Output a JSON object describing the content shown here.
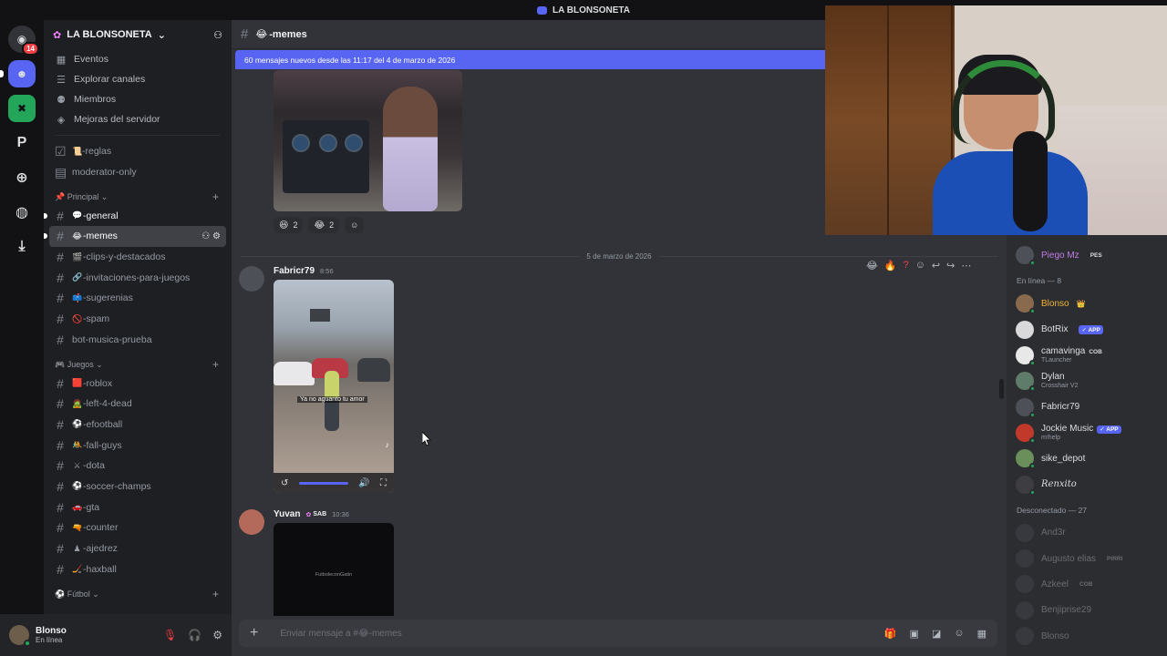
{
  "window": {
    "title": "LA BLONSONETA"
  },
  "rail": {
    "dm_badge": "14",
    "letter_server": "P"
  },
  "server": {
    "name": "LA BLONSONETA"
  },
  "nav": [
    {
      "label": "Eventos"
    },
    {
      "label": "Explorar canales"
    },
    {
      "label": "Miembros"
    },
    {
      "label": "Mejoras del servidor"
    }
  ],
  "top_channels": [
    {
      "emoji": "📜",
      "label": "-reglas"
    },
    {
      "emoji": "",
      "label": "moderator-only"
    }
  ],
  "categories": {
    "principal": "Principal",
    "juegos": "Juegos",
    "futbol": "Fútbol"
  },
  "principal_channels": [
    {
      "emoji": "💬",
      "label": "-general"
    },
    {
      "emoji": "😂",
      "label": "-memes"
    },
    {
      "emoji": "🎬",
      "label": "-clips-y-destacados"
    },
    {
      "emoji": "🔗",
      "label": "-invitaciones-para-juegos"
    },
    {
      "emoji": "📫",
      "label": "-sugerenias"
    },
    {
      "emoji": "🚫",
      "label": "-spam"
    },
    {
      "emoji": "",
      "label": "bot-musica-prueba"
    }
  ],
  "juegos_channels": [
    {
      "emoji": "🟥",
      "label": "-roblox"
    },
    {
      "emoji": "🧟",
      "label": "-left-4-dead"
    },
    {
      "emoji": "⚽",
      "label": "-efootball"
    },
    {
      "emoji": "🤼",
      "label": "-fall-guys"
    },
    {
      "emoji": "⚔",
      "label": "-dota"
    },
    {
      "emoji": "⚽",
      "label": "-soccer-champs"
    },
    {
      "emoji": "🚗",
      "label": "-gta"
    },
    {
      "emoji": "🔫",
      "label": "-counter"
    },
    {
      "emoji": "♟",
      "label": "-ajedrez"
    },
    {
      "emoji": "🏒",
      "label": "-haxball"
    }
  ],
  "user": {
    "name": "Blonso",
    "status": "En línea"
  },
  "channel": {
    "name": "-memes",
    "emoji": "😂"
  },
  "new_messages_bar": "60 mensajes nuevos desde las 11:17 del 4 de marzo de 2026",
  "reactions": [
    {
      "emoji": "😆",
      "count": "2"
    },
    {
      "emoji": "😂",
      "count": "2"
    }
  ],
  "date_divider": "5 de marzo de 2026",
  "messages": [
    {
      "author": "Fabricr79",
      "time": "8:56"
    },
    {
      "author": "Yuvan",
      "tag": "SAB",
      "time": "10:36"
    }
  ],
  "video_caption": "Ya no aguanto tu amor",
  "video2_watermark": "FutboleconGatin",
  "composer": {
    "placeholder": "Enviar mensaje a #😂-memes"
  },
  "members": {
    "top": {
      "name": "Piego Mz",
      "tag": "PES"
    },
    "online_header": "En línea — 8",
    "online": [
      {
        "name": "Blonso",
        "crown": "👑",
        "sub": ""
      },
      {
        "name": "BotRix",
        "app": "✓ APP",
        "sub": ""
      },
      {
        "name": "camavinga",
        "tag": "COB",
        "sub": "TLauncher"
      },
      {
        "name": "Dylan",
        "sub": "Crosshair V2"
      },
      {
        "name": "Fabricr79",
        "sub": ""
      },
      {
        "name": "Jockie Music",
        "app": "✓ APP",
        "sub": "m!help"
      },
      {
        "name": "sike_depot",
        "sub": ""
      },
      {
        "name": "Renxito",
        "sub": ""
      }
    ],
    "offline_header": "Desconectado — 27",
    "offline": [
      {
        "name": "And3r",
        "tag": ""
      },
      {
        "name": "Augusto elias",
        "tag": "PIRRI"
      },
      {
        "name": "Azkeel",
        "tag": "COB"
      },
      {
        "name": "Benjiprise29",
        "tag": ""
      },
      {
        "name": "Blonso",
        "tag": ""
      }
    ]
  },
  "colors": {
    "accent": "#5865f2",
    "online": "#23a55a",
    "danger": "#f23f43",
    "pink": "#f47fff"
  }
}
